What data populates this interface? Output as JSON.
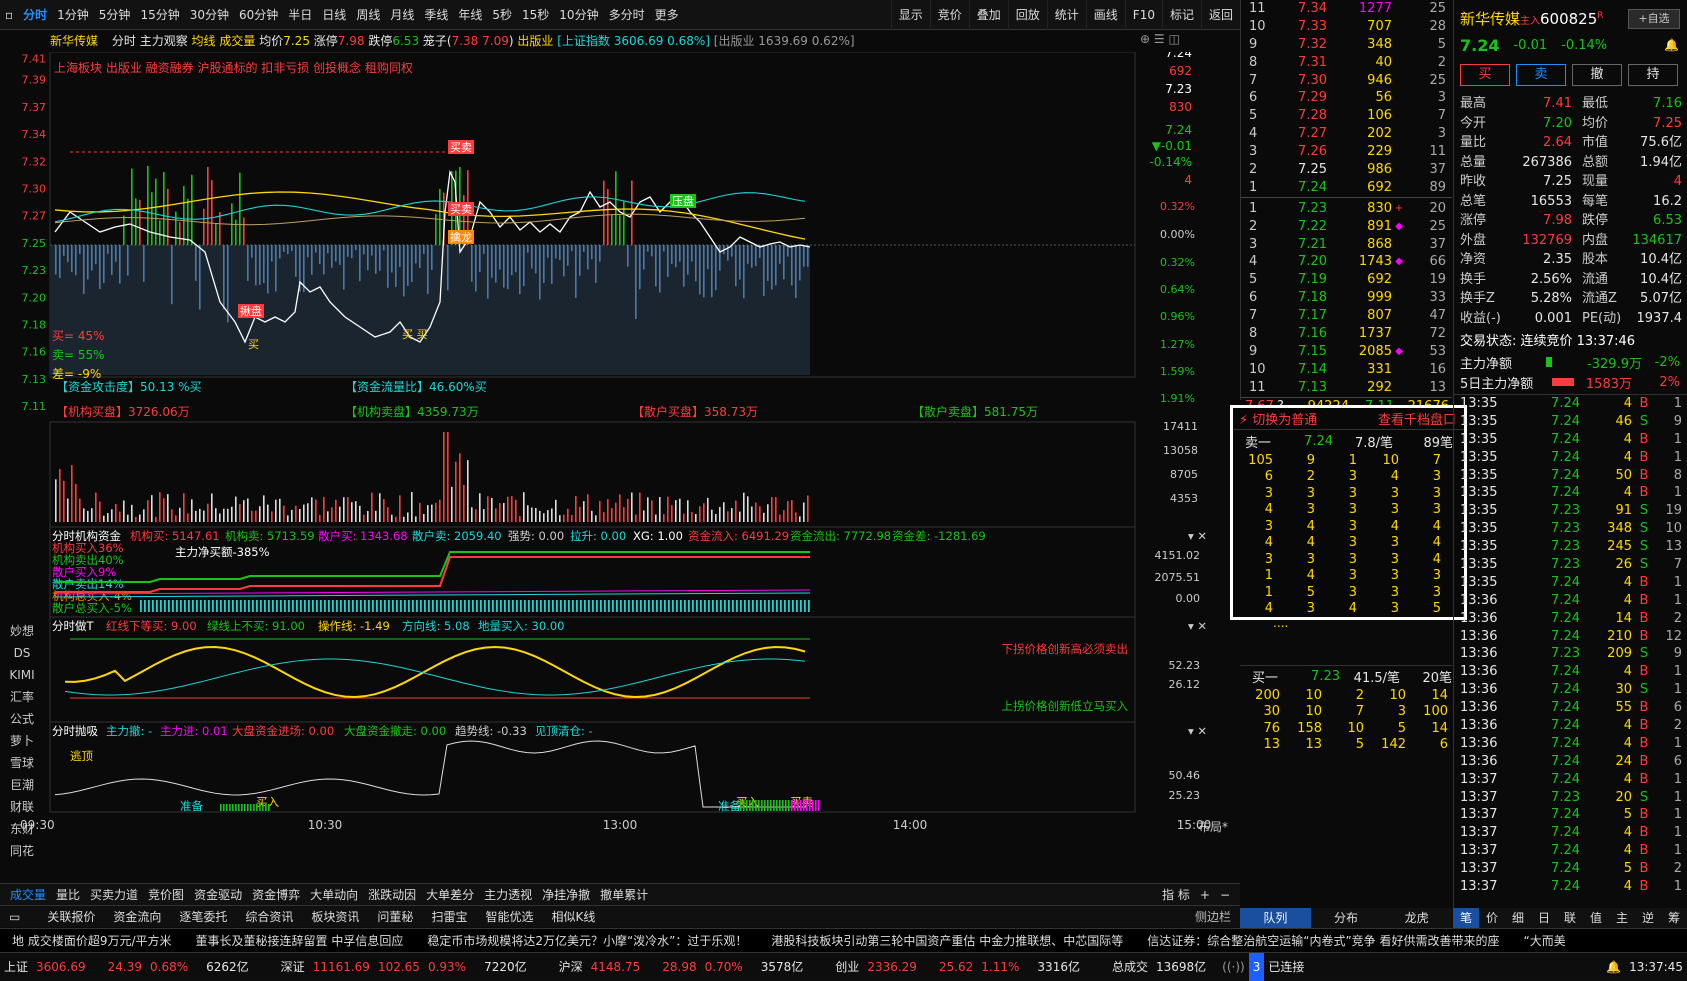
{
  "toolbar": {
    "periods": [
      "分时",
      "1分钟",
      "5分钟",
      "15分钟",
      "30分钟",
      "60分钟",
      "半日",
      "日线",
      "周线",
      "月线",
      "季线",
      "年线",
      "5秒",
      "15秒",
      "10分钟",
      "多分时",
      "更多"
    ],
    "tools": [
      "显示",
      "竞价",
      "叠加",
      "回放",
      "统计",
      "画线",
      "F10",
      "标记",
      "返回"
    ]
  },
  "info": {
    "name": "新华传媒",
    "mode": "分时",
    "watch": "主力观察",
    "avg": "均线",
    "vol": "成交量",
    "avgp_l": "均价",
    "avgp": "7.25",
    "zt_l": "涨停",
    "zt": "7.98",
    "dt_l": "跌停",
    "dt": "6.53",
    "lz_l": "笼子(",
    "lz": "7.38 7.09",
    "lz_e": ")",
    "ind": "出版业",
    "idx": "[上证指数 3606.69 0.68%]",
    "idx2": "[出版业 1639.69 0.62%]"
  },
  "concepts": "上海板块 出版业 融资融券 沪股通标的 扣非亏损 创投概念 租购同权",
  "price_axis": [
    "7.41",
    "7.39",
    "7.37",
    "7.34",
    "7.32",
    "7.30",
    "7.27",
    "7.25",
    "7.23",
    "7.20",
    "7.18",
    "7.16",
    "7.13",
    "7.11"
  ],
  "pct_axis": [
    "0.32%",
    "0.00%",
    "0.32%",
    "0.64%",
    "0.96%",
    "1.27%",
    "1.59%",
    "1.91%"
  ],
  "right_marks": {
    "p1": "7.24",
    "v1": "692",
    "p2": "7.23",
    "v2": "830",
    "cur": "7.24",
    "chg": "▼-0.01",
    "chgp": "-0.14%",
    "n": "4"
  },
  "buy_sell": {
    "buy": "买= 45%",
    "sell": "卖= 55%",
    "diff": "差= -9%"
  },
  "signals": {
    "nibang": "擒龙",
    "mai": "买卖",
    "yasu": "压盘",
    "buy1": "买",
    "buy2": "买 买",
    "jiu": "揪盘",
    "maitop": "买卖"
  },
  "flow1": {
    "a": "【资金攻击度】50.13 %买",
    "b": "【资金流量比】46.60%买"
  },
  "flow2": {
    "a": "【机构买盘】3726.06万",
    "b": "【机构卖盘】4359.73万",
    "c": "【散户买盘】358.73万",
    "d": "【散户卖盘】581.75万"
  },
  "vol_axis": [
    "17411",
    "13058",
    "8705",
    "4353"
  ],
  "panel1": {
    "title": "分时机构资金",
    "a": "机构买: 5147.61",
    "b": "机构卖: 5713.59",
    "c": "散户买: 1343.68",
    "d": "散户卖: 2059.40",
    "e": "强势: 0.00",
    "f": "拉升: 0.00",
    "g": "XG: 1.00",
    "h": "资金流入: 6491.29",
    "i": "资金流出: 7772.98",
    "j": "资金差: -1281.69",
    "l1": "机构买入36%",
    "l2": "机构卖出40%",
    "l3": "散户买入9%",
    "l4": "散户卖出14%",
    "l5": "机构总买入-4%",
    "l6": "散户总买入-5%",
    "main": "主力净买额-385%",
    "ax": [
      "4151.02",
      "2075.51",
      "0.00"
    ]
  },
  "panel2": {
    "title": "分时做T",
    "a": "红线下等买: 9.00",
    "b": "绿线上不买: 91.00",
    "c": "操作线: -1.49",
    "d": "方向线: 5.08",
    "e": "地量买入: 30.00",
    "note1": "下拐价格创新高必须卖出",
    "note2": "上拐价格创新低立马买入",
    "ax": [
      "52.23",
      "26.12"
    ]
  },
  "panel3": {
    "title": "分时抛吸",
    "a": "主力撤: -",
    "b": "主力进: 0.01",
    "c": "大盘资金进场: 0.00",
    "d": "大盘资金撤走: 0.00",
    "e": "趋势线: -0.33",
    "f": "见顶清仓: -",
    "top": "逃顶",
    "ax": [
      "50.46",
      "25.23"
    ],
    "m1": "准备",
    "m2": "买入",
    "m3": "准备",
    "m4": "买入",
    "m5": "买卖"
  },
  "time_axis": [
    "09:30",
    "10:30",
    "13:00",
    "14:00",
    "15:00"
  ],
  "layout_btn": "布局*",
  "vtabs": [
    "妙想",
    "DS",
    "KIMI",
    "汇率",
    "公式",
    "萝卜",
    "雪球",
    "巨潮",
    "财联",
    "东财",
    "同花"
  ],
  "btabs": [
    "成交量",
    "量比",
    "买卖力道",
    "竞价图",
    "资金驱动",
    "资金博弈",
    "大单动向",
    "涨跌动因",
    "大单差分",
    "主力透视",
    "净挂净撤",
    "撤单累计"
  ],
  "btabs_r": [
    "指 标",
    "+",
    "−"
  ],
  "btabs2": [
    "关联报价",
    "资金流向",
    "逐笔委托",
    "综合资讯",
    "板块资讯",
    "问董秘",
    "扫雷宝",
    "智能优选",
    "相似K线"
  ],
  "side_btn": "侧边栏",
  "ticker": [
    "地 成交楼面价超9万元/平方米",
    "董事长及董秘接连辞留置 中孚信息回应",
    "稳定币市场规模将达2万亿美元？小摩“泼冷水”：过于乐观！",
    "港股科技板块引动第三轮中国资产重估 中金力推联想、中芯国际等",
    "信达证券：综合整治航空运输“内卷式”竞争 看好供需改善带来的座",
    "“大而美"
  ],
  "status": {
    "sh_l": "上证",
    "sh": "3606.69",
    "sh_c": "24.39",
    "sh_p": "0.68%",
    "sh_a": "6262亿",
    "sz_l": "深证",
    "sz": "11161.69",
    "sz_c": "102.65",
    "sz_p": "0.93%",
    "sz_a": "7220亿",
    "hs_l": "沪深",
    "hs": "4148.75",
    "hs_c": "28.98",
    "hs_p": "0.70%",
    "hs_a": "3578亿",
    "cy_l": "创业",
    "cy": "2336.29",
    "cy_c": "25.62",
    "cy_p": "1.11%",
    "cy_a": "3316亿",
    "tot_l": "总成交",
    "tot": "13698亿",
    "conn": "已连接",
    "time": "13:37:45"
  },
  "book": {
    "sells": [
      [
        "11",
        "7.34",
        "1277",
        "25"
      ],
      [
        "10",
        "7.33",
        "707",
        "28"
      ],
      [
        "9",
        "7.32",
        "348",
        "5"
      ],
      [
        "8",
        "7.31",
        "40",
        "2"
      ],
      [
        "7",
        "7.30",
        "946",
        "25"
      ],
      [
        "6",
        "7.29",
        "56",
        "3"
      ],
      [
        "5",
        "7.28",
        "106",
        "7"
      ],
      [
        "4",
        "7.27",
        "202",
        "3"
      ],
      [
        "3",
        "7.26",
        "229",
        "11"
      ],
      [
        "2",
        "7.25",
        "986",
        "37"
      ],
      [
        "1",
        "7.24",
        "692",
        "89"
      ]
    ],
    "buys": [
      [
        "1",
        "7.23",
        "830",
        "20"
      ],
      [
        "2",
        "7.22",
        "891",
        "25"
      ],
      [
        "3",
        "7.21",
        "868",
        "37"
      ],
      [
        "4",
        "7.20",
        "1743",
        "66"
      ],
      [
        "5",
        "7.19",
        "692",
        "19"
      ],
      [
        "6",
        "7.18",
        "999",
        "33"
      ],
      [
        "7",
        "7.17",
        "807",
        "47"
      ],
      [
        "8",
        "7.16",
        "1737",
        "72"
      ],
      [
        "9",
        "7.15",
        "2085",
        "53"
      ],
      [
        "10",
        "7.14",
        "331",
        "16"
      ],
      [
        "11",
        "7.13",
        "292",
        "13"
      ]
    ],
    "foot": [
      "7.67",
      "?",
      "94224",
      "7.11",
      "21676"
    ]
  },
  "queue": {
    "hdr1": "⚡ 切换为普通",
    "hdr2": "查看千档盘口",
    "s_l": "卖一",
    "s_p": "7.24",
    "s_a": "7.8/笔",
    "s_n": "89笔",
    "rows": [
      [
        "105",
        "9",
        "1",
        "10",
        "7"
      ],
      [
        "6",
        "2",
        "3",
        "4",
        "3"
      ],
      [
        "3",
        "3",
        "3",
        "3",
        "3"
      ],
      [
        "4",
        "3",
        "3",
        "3",
        "3"
      ],
      [
        "3",
        "4",
        "3",
        "4",
        "4"
      ],
      [
        "4",
        "4",
        "3",
        "3",
        "4"
      ],
      [
        "3",
        "3",
        "3",
        "3",
        "4"
      ],
      [
        "1",
        "4",
        "3",
        "3",
        "3"
      ],
      [
        "1",
        "5",
        "3",
        "3",
        "3"
      ],
      [
        "4",
        "3",
        "4",
        "3",
        "5"
      ]
    ],
    "more": "....",
    "b_l": "买一",
    "b_p": "7.23",
    "b_a": "41.5/笔",
    "b_n": "20笔",
    "brows": [
      [
        "200",
        "10",
        "2",
        "10",
        "14"
      ],
      [
        "30",
        "10",
        "7",
        "3",
        "100"
      ],
      [
        "76",
        "158",
        "10",
        "5",
        "14"
      ],
      [
        "13",
        "13",
        "5",
        "142",
        "6"
      ]
    ]
  },
  "qtabs": [
    "队列",
    "分布",
    "龙虎"
  ],
  "stock": {
    "name": "新华传媒",
    "flag": "主入",
    "code": "600825",
    "r": "R",
    "price": "7.24",
    "chg": "-0.01",
    "pct": "-0.14%",
    "add": "+自选",
    "btns": [
      "买",
      "卖",
      "撤",
      "持"
    ]
  },
  "stats": [
    [
      "最高",
      "7.41",
      "最低",
      "7.16"
    ],
    [
      "今开",
      "7.20",
      "均价",
      "7.25"
    ],
    [
      "量比",
      "2.64",
      "市值",
      "75.6亿"
    ],
    [
      "总量",
      "267386",
      "总额",
      "1.94亿"
    ],
    [
      "昨收",
      "7.25",
      "现量",
      "4"
    ],
    [
      "总笔",
      "16553",
      "每笔",
      "16.2"
    ],
    [
      "涨停",
      "7.98",
      "跌停",
      "6.53"
    ],
    [
      "外盘",
      "132769",
      "内盘",
      "134617"
    ],
    [
      "净资",
      "2.35",
      "股本",
      "10.4亿"
    ],
    [
      "换手",
      "2.56%",
      "流通",
      "10.4亿"
    ],
    [
      "换手Z",
      "5.28%",
      "流通Z",
      "5.07亿"
    ],
    [
      "收益(-)",
      "0.001",
      "PE(动)",
      "1937.4"
    ]
  ],
  "state": "交易状态: 连续竞价 13:37:46",
  "mainflow": {
    "l1": "主力净额",
    "v1": "-329.9万",
    "p1": "-2%",
    "l2": "5日主力净额",
    "v2": "1583万",
    "p2": "2%"
  },
  "trades": [
    [
      "13:35",
      "7.24",
      "4",
      "B",
      "1"
    ],
    [
      "13:35",
      "7.24",
      "46",
      "S",
      "9"
    ],
    [
      "13:35",
      "7.24",
      "4",
      "B",
      "1"
    ],
    [
      "13:35",
      "7.24",
      "4",
      "B",
      "1"
    ],
    [
      "13:35",
      "7.24",
      "50",
      "B",
      "8"
    ],
    [
      "13:35",
      "7.24",
      "4",
      "B",
      "1"
    ],
    [
      "13:35",
      "7.23",
      "91",
      "S",
      "19"
    ],
    [
      "13:35",
      "7.23",
      "348",
      "S",
      "10"
    ],
    [
      "13:35",
      "7.23",
      "245",
      "S",
      "13"
    ],
    [
      "13:35",
      "7.23",
      "26",
      "S",
      "7"
    ],
    [
      "13:35",
      "7.24",
      "4",
      "B",
      "1"
    ],
    [
      "13:36",
      "7.24",
      "4",
      "B",
      "1"
    ],
    [
      "13:36",
      "7.24",
      "14",
      "B",
      "2"
    ],
    [
      "13:36",
      "7.24",
      "210",
      "B",
      "12"
    ],
    [
      "13:36",
      "7.23",
      "209",
      "S",
      "9"
    ],
    [
      "13:36",
      "7.24",
      "4",
      "B",
      "1"
    ],
    [
      "13:36",
      "7.24",
      "30",
      "S",
      "1"
    ],
    [
      "13:36",
      "7.24",
      "55",
      "B",
      "6"
    ],
    [
      "13:36",
      "7.24",
      "4",
      "B",
      "2"
    ],
    [
      "13:36",
      "7.24",
      "4",
      "B",
      "1"
    ],
    [
      "13:36",
      "7.24",
      "24",
      "B",
      "6"
    ],
    [
      "13:37",
      "7.24",
      "4",
      "B",
      "1"
    ],
    [
      "13:37",
      "7.23",
      "20",
      "S",
      "1"
    ],
    [
      "13:37",
      "7.24",
      "5",
      "B",
      "1"
    ],
    [
      "13:37",
      "7.24",
      "4",
      "B",
      "1"
    ],
    [
      "13:37",
      "7.24",
      "4",
      "B",
      "1"
    ],
    [
      "13:37",
      "7.24",
      "5",
      "B",
      "2"
    ],
    [
      "13:37",
      "7.24",
      "4",
      "B",
      "1"
    ]
  ],
  "ttabs": [
    "笔",
    "价",
    "细",
    "日",
    "联",
    "值",
    "主",
    "逆",
    "筹"
  ],
  "colors": {
    "up": "#ff3b3b",
    "down": "#18c418",
    "price_line": "#ffffff",
    "avg_line": "#ffd800"
  }
}
